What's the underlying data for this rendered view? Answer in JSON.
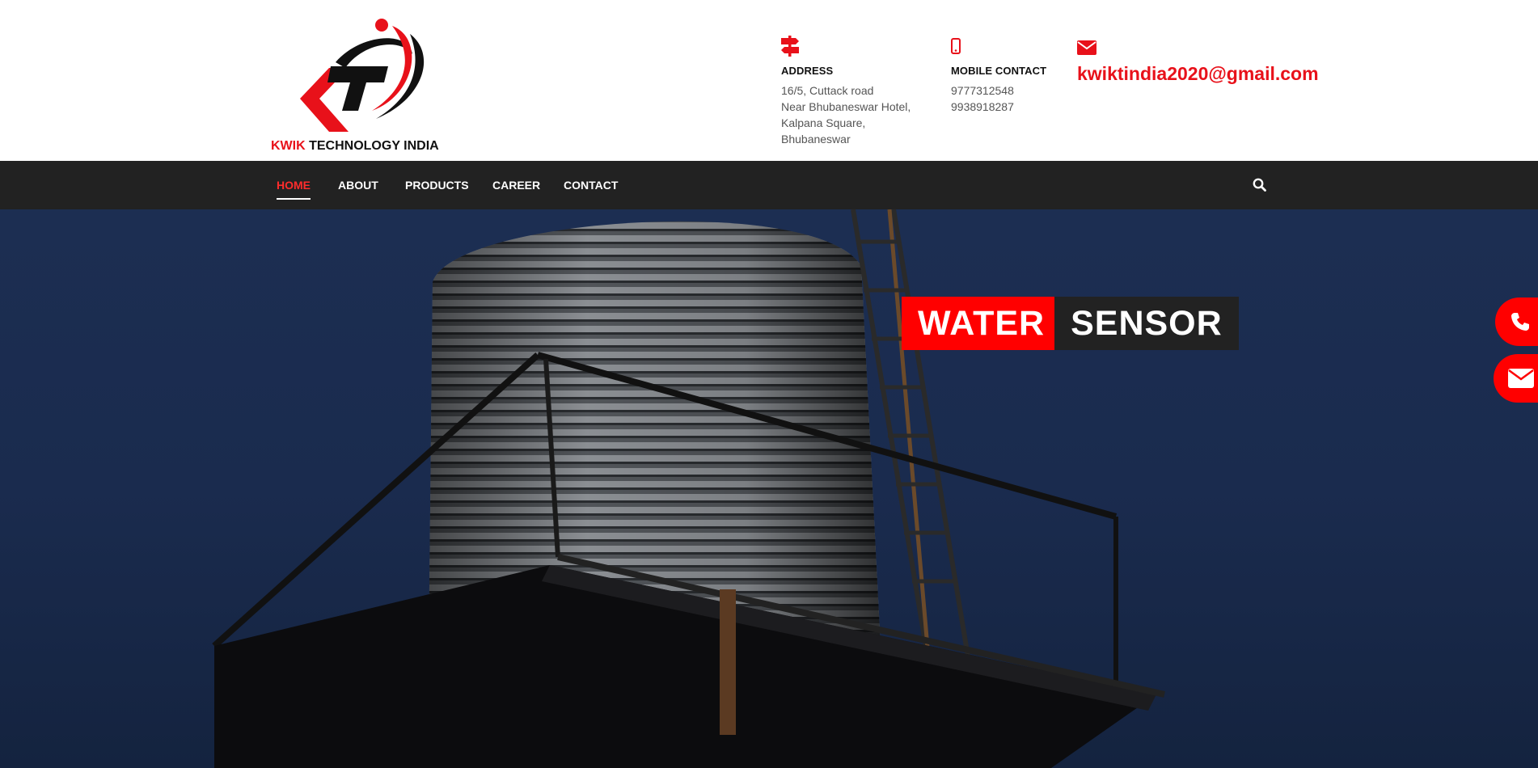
{
  "brand": {
    "name_red": "KWIK",
    "name_rest": " TECHNOLOGY INDIA",
    "accent": "#e8111a"
  },
  "contact": {
    "address": {
      "icon": "signpost-icon",
      "title": "ADDRESS",
      "lines": [
        "16/5, Cuttack road",
        "Near Bhubaneswar Hotel,",
        "Kalpana Square,",
        "Bhubaneswar"
      ]
    },
    "mobile": {
      "icon": "mobile-phone-icon",
      "title": "MOBILE CONTACT",
      "lines": [
        "9777312548",
        "9938918287"
      ]
    },
    "email": {
      "icon": "envelope-icon",
      "value": "kwiktindia2020@gmail.com"
    }
  },
  "nav": {
    "items": [
      "HOME",
      "ABOUT",
      "PRODUCTS",
      "CAREER",
      "CONTACT"
    ],
    "active": "HOME",
    "search_icon": "search-icon"
  },
  "hero": {
    "banner_word1": "WATER",
    "banner_word2": "SENSOR"
  },
  "floating": {
    "call_icon": "phone-icon",
    "mail_icon": "envelope-icon"
  },
  "colors": {
    "nav_bg": "#222222",
    "banner_red": "#ff0000",
    "banner_dark": "#222222",
    "hero_sky": "#1a2b4e"
  }
}
